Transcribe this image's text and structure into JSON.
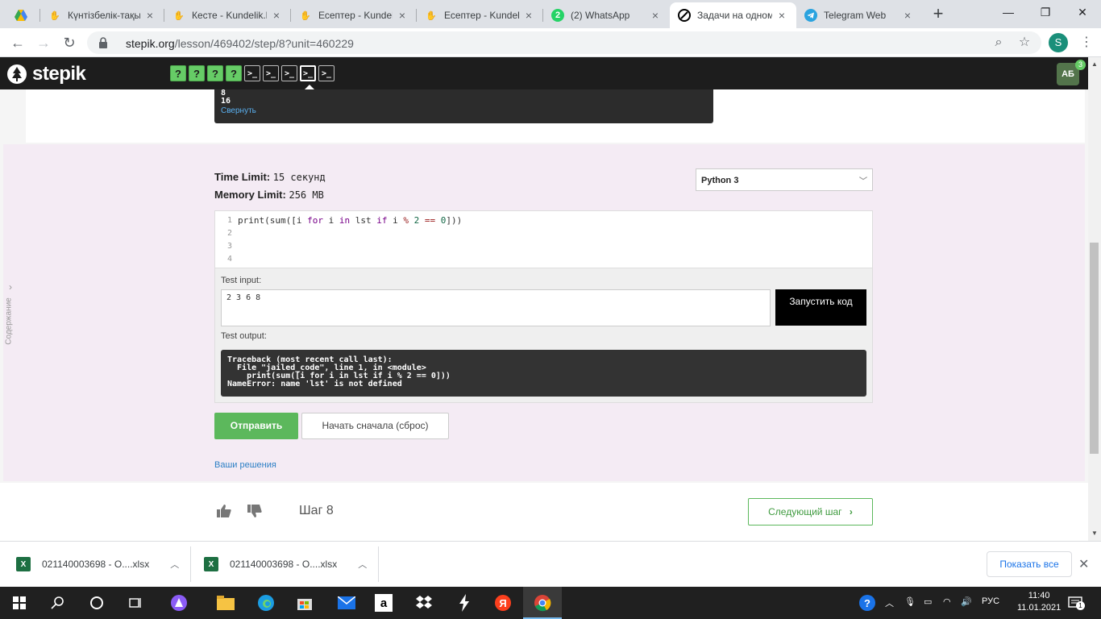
{
  "tabs": [
    {
      "title": "",
      "favicon": "google-drive-icon"
    },
    {
      "title": "Күнтізбелік-тақы",
      "favicon": "kundelik-icon"
    },
    {
      "title": "Кесте - Kundelik.k",
      "favicon": "kundelik-icon"
    },
    {
      "title": "Есептер - Kundelik",
      "favicon": "kundelik-icon"
    },
    {
      "title": "Есептер - Kundelik",
      "favicon": "kundelik-icon"
    },
    {
      "title": "(2) WhatsApp",
      "favicon": "whatsapp-icon",
      "badge": "2"
    },
    {
      "title": "Задачи на одном",
      "favicon": "stepik-icon"
    },
    {
      "title": "Telegram Web",
      "favicon": "telegram-icon"
    }
  ],
  "address": {
    "host": "stepik.org",
    "path": "/lesson/469402/step/8?unit=460229"
  },
  "profile_initial": "S",
  "stepik": {
    "logo_text": "stepik",
    "steps": [
      "?",
      "?",
      "?",
      "?",
      ">_",
      ">_",
      ">_",
      ">_",
      ">_"
    ],
    "avatar": "АБ",
    "notifications": "3"
  },
  "prev_output": {
    "lines": [
      "8",
      "16"
    ],
    "collapse": "Свернуть"
  },
  "sidebar_label": "Содержание",
  "limits": {
    "time_label": "Time Limit:",
    "time_value": "15 секунд",
    "memory_label": "Memory Limit:",
    "memory_value": "256 MB"
  },
  "language": "Python 3",
  "editor": {
    "line_numbers": [
      "1",
      "2",
      "3",
      "4"
    ]
  },
  "test": {
    "input_label": "Test input:",
    "input_value": "2 3 6 8",
    "run_label": "Запустить код",
    "output_label": "Test output:",
    "output_text": "Traceback (most recent call last):\n  File \"jailed_code\", line 1, in <module>\n    print(sum([i for i in lst if i % 2 == 0]))\nNameError: name 'lst' is not defined"
  },
  "actions": {
    "submit": "Отправить",
    "reset": "Начать сначала (сброс)",
    "solutions": "Ваши решения"
  },
  "footer": {
    "step": "Шаг 8",
    "next": "Следующий шаг"
  },
  "downloads": [
    {
      "name": "021140003698 - О....xlsx"
    },
    {
      "name": "021140003698 - О....xlsx"
    }
  ],
  "show_all": "Показать все",
  "taskbar": {
    "lang": "РУС",
    "time": "11:40",
    "date": "11.01.2021",
    "notif_count": "1"
  },
  "colors": {
    "stepik_green": "#66cc66",
    "header_bg": "#1d1d1d",
    "section_bg": "#f4ebf4"
  }
}
